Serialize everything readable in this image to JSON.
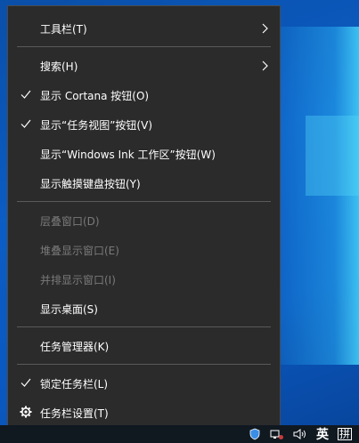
{
  "menu": {
    "items": [
      {
        "label": "工具栏(T)",
        "submenu": true
      },
      {
        "label": "搜索(H)",
        "submenu": true
      },
      {
        "label": "显示 Cortana 按钮(O)",
        "checked": true
      },
      {
        "label": "显示“任务视图”按钮(V)",
        "checked": true
      },
      {
        "label": "显示“Windows Ink 工作区”按钮(W)"
      },
      {
        "label": "显示触摸键盘按钮(Y)"
      },
      {
        "label": "层叠窗口(D)",
        "disabled": true
      },
      {
        "label": "堆叠显示窗口(E)",
        "disabled": true
      },
      {
        "label": "并排显示窗口(I)",
        "disabled": true
      },
      {
        "label": "显示桌面(S)"
      },
      {
        "label": "任务管理器(K)"
      },
      {
        "label": "锁定任务栏(L)",
        "checked": true
      },
      {
        "label": "任务栏设置(T)",
        "icon": "gear-icon"
      }
    ]
  },
  "taskbar": {
    "input_mode": "英",
    "ime_mode": "拼"
  },
  "colors": {
    "menu_bg": "#2b2b2b",
    "menu_text": "#ffffff",
    "disabled_text": "#7a7a7a",
    "separator": "#5a5a5a"
  }
}
